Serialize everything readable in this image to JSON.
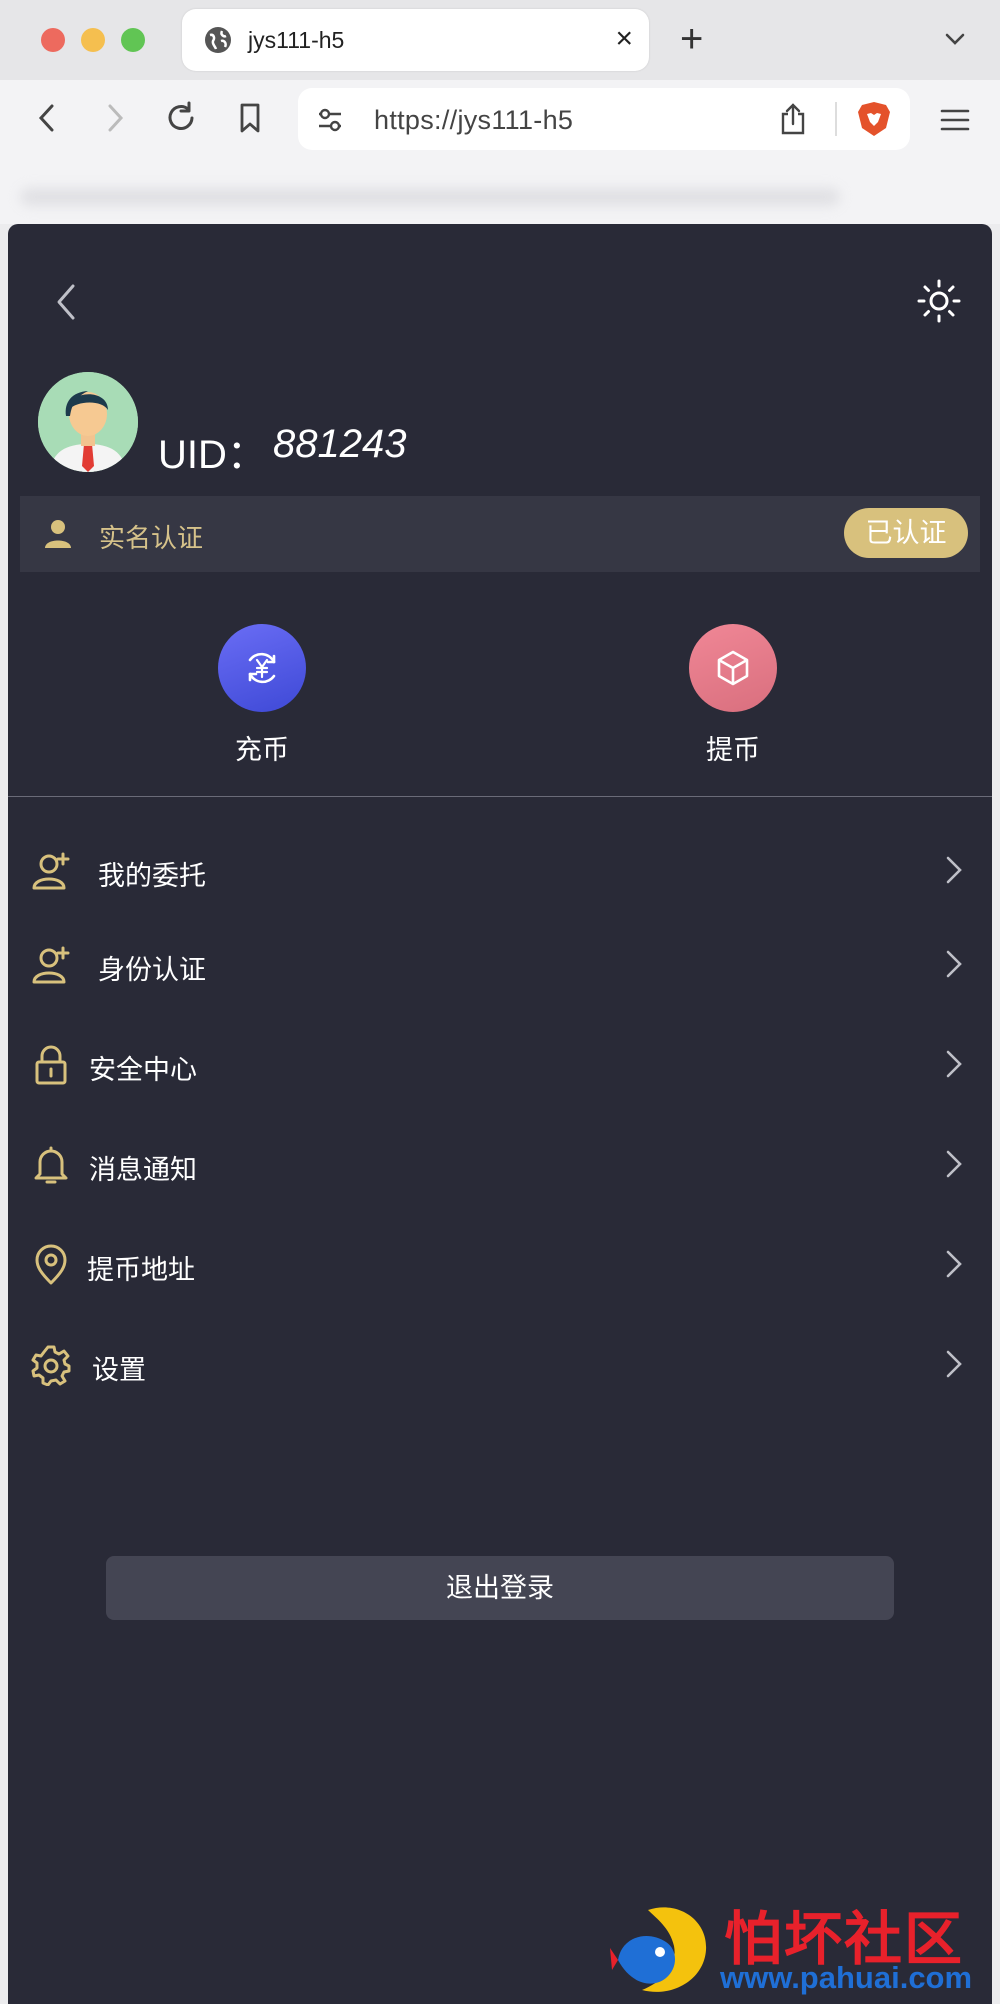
{
  "browser": {
    "tab_title": "jys111-h5",
    "tab_close": "×",
    "new_tab": "+",
    "url": "https://jys111-h5"
  },
  "profile": {
    "uid_label": "UID：",
    "uid_value": "881243"
  },
  "verification": {
    "label": "实名认证",
    "status": "已认证"
  },
  "actions": [
    {
      "label": "充币",
      "icon": "yuan-exchange-icon",
      "color": "#5258e6"
    },
    {
      "label": "提币",
      "icon": "cube-icon",
      "color": "#e57b89"
    }
  ],
  "menu": [
    {
      "label": "我的委托",
      "icon": "user-add-icon"
    },
    {
      "label": "身份认证",
      "icon": "user-add-icon"
    },
    {
      "label": "安全中心",
      "icon": "lock-icon"
    },
    {
      "label": "消息通知",
      "icon": "bell-icon"
    },
    {
      "label": "提币地址",
      "icon": "location-pin-icon"
    },
    {
      "label": "设置",
      "icon": "gear-icon"
    }
  ],
  "logout_label": "退出登录",
  "watermark": {
    "title": "怕坏社区",
    "url": "www.pahuai.com"
  },
  "colors": {
    "background": "#292a37",
    "accent_gold": "#d8c17d",
    "row_bg": "#363744"
  }
}
